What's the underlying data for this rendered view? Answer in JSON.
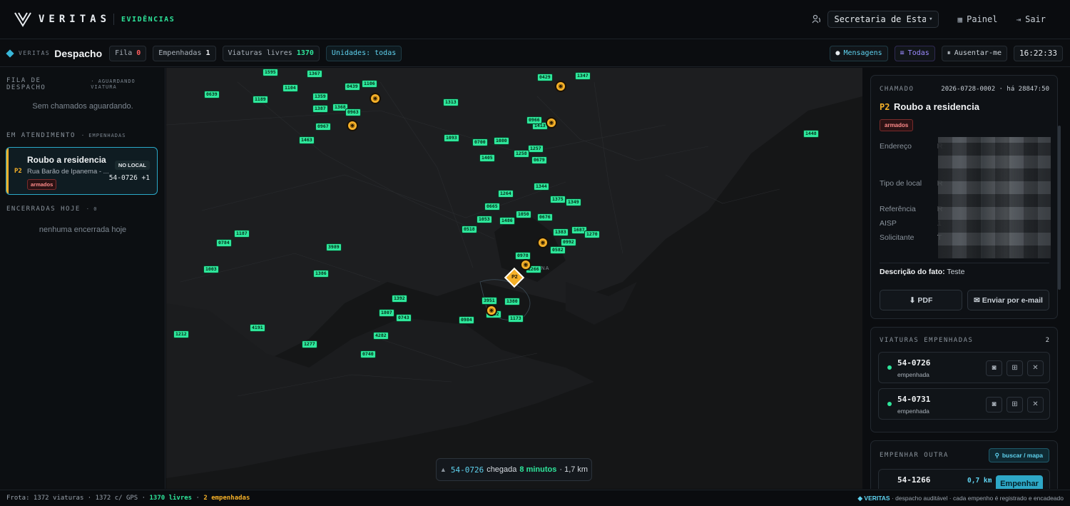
{
  "app": {
    "brand": "VERITAS",
    "section": "EVIDÊNCIAS"
  },
  "topbar": {
    "secretaria": "Secretaria de Estado",
    "painel": "Painel",
    "sair": "Sair"
  },
  "subbar": {
    "crumb_small": "VERITAS",
    "title": "Despacho",
    "fila_label": "Fila",
    "fila_value": "0",
    "empenhadas_label": "Empenhadas",
    "empenhadas_value": "1",
    "livres_label": "Viaturas livres",
    "livres_value": "1370",
    "unidades": "Unidades: todas",
    "mensagens": "Mensagens",
    "todas": "Todas",
    "ausentar": "Ausentar-me",
    "clock": "16:22:33"
  },
  "sidebar": {
    "fila_h": "FILA DE DESPACHO",
    "fila_sub": "AGUARDANDO VIATURA",
    "fila_empty": "Sem chamados aguardando.",
    "atend_h": "EM ATENDIMENTO",
    "atend_sub": "EMPENHADAS",
    "card": {
      "priority": "P2",
      "title": "Roubo a residencia",
      "address": "Rua Barão de Ipanema - ...",
      "tag": "armados",
      "status": "NO LOCAL",
      "unit": "54-0726 +1"
    },
    "enc_h": "ENCERRADAS HOJE",
    "enc_count": "0",
    "enc_empty": "nenhuma encerrada hoje"
  },
  "map": {
    "markers": [
      "1595",
      "1367",
      "0639",
      "1104",
      "1189",
      "1359",
      "1387",
      "1368",
      "0439",
      "1106",
      "0963",
      "0967",
      "1463",
      "1313",
      "0429",
      "1347",
      "1413",
      "0966",
      "1257",
      "1093",
      "0700",
      "1080",
      "1405",
      "1258",
      "0679",
      "1264",
      "1344",
      "1375",
      "1349",
      "0665",
      "1050",
      "0676",
      "1053",
      "1486",
      "0518",
      "1383",
      "1687",
      "1270",
      "3989",
      "0978",
      "0992",
      "0582",
      "1187",
      "0784",
      "1386",
      "1003",
      "1266",
      "1392",
      "3951",
      "1380",
      "4292",
      "1173",
      "1807",
      "0743",
      "0984",
      "4191",
      "4282",
      "1212",
      "1277",
      "0740",
      "1448"
    ],
    "p2_label": "P2",
    "area_label": "ANA",
    "eta": {
      "unit": "54-0726",
      "text1": "chegada",
      "minutes": "8 minutos",
      "text2": "· 1,7 km"
    }
  },
  "panel": {
    "chamado_h": "CHAMADO",
    "chamado_id": "2026-0728-0002 · há 28847:50",
    "priority": "P2",
    "title": "Roubo a residencia",
    "tag": "armados",
    "endereco_k": "Endereço",
    "endereco_v": "R",
    "tipo_k": "Tipo de local",
    "tipo_v": "R",
    "ref_k": "Referência",
    "ref_v": "R",
    "aisp_k": "AISP",
    "aisp_v": "1",
    "sol_k": "Solicitante",
    "sol_v": "T",
    "desc_k": "Descrição do fato:",
    "desc_v": "Teste",
    "pdf": "⬇ PDF",
    "email": "✉ Enviar por e-mail",
    "viaturas_h": "VIATURAS EMPENHADAS",
    "viaturas_count": "2",
    "viaturas": [
      {
        "id": "54-0726",
        "status": "empenhada"
      },
      {
        "id": "54-0731",
        "status": "empenhada"
      }
    ],
    "empenhar_h": "EMPENHAR OUTRA",
    "buscar": "buscar / mapa",
    "cand": {
      "id": "54-1266",
      "dist": "0,7 km",
      "btn": "Empenhar"
    }
  },
  "footer": {
    "frota": "Frota: 1372 viaturas · 1372 c/ GPS ·",
    "livres": "1370 livres",
    "sep": "·",
    "emp": "2 empenhadas",
    "right_brand": "◆ VERITAS",
    "right_text": "· despacho auditável · cada empenho é registrado e encadeado"
  },
  "colors": {
    "accent": "#2ee69b",
    "cyan": "#5fd3f0",
    "amber": "#f5b028",
    "danger": "#ff5d5d"
  }
}
